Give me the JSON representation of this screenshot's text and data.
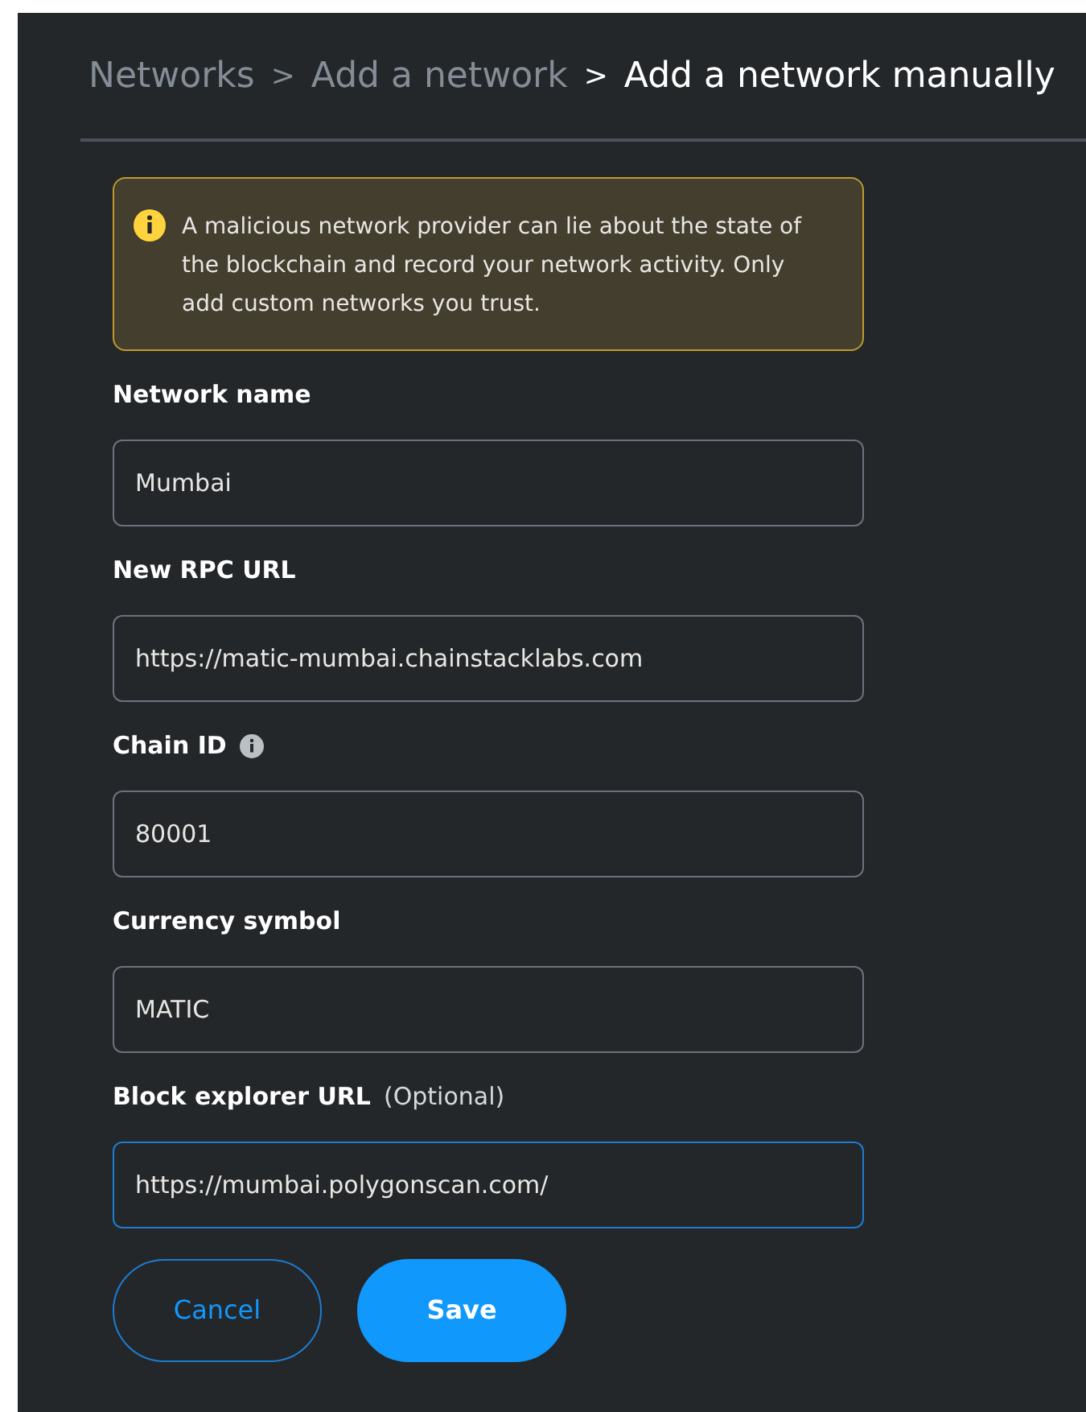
{
  "breadcrumb": [
    {
      "label": "Networks",
      "current": false
    },
    {
      "label": "Add a network",
      "current": false
    },
    {
      "label": "Add a network manually",
      "current": true
    }
  ],
  "separator": ">",
  "warning": {
    "text": "A malicious network provider can lie about the state of the blockchain and record your network activity. Only add custom networks you trust."
  },
  "fields": [
    {
      "label": "Network name",
      "value": "Mumbai",
      "info": false,
      "focused": false
    },
    {
      "label": "New RPC URL",
      "value": "https://matic-mumbai.chainstacklabs.com",
      "info": false,
      "focused": false
    },
    {
      "label": "Chain ID",
      "value": "80001",
      "info": true,
      "focused": false
    },
    {
      "label": "Currency symbol",
      "value": "MATIC",
      "info": false,
      "focused": false
    },
    {
      "label": "Block explorer URL",
      "note": "(Optional)",
      "value": "https://mumbai.polygonscan.com/",
      "info": false,
      "focused": true
    }
  ],
  "buttons": [
    {
      "label": "Cancel",
      "kind": "secondary"
    },
    {
      "label": "Save",
      "kind": "primary"
    }
  ]
}
